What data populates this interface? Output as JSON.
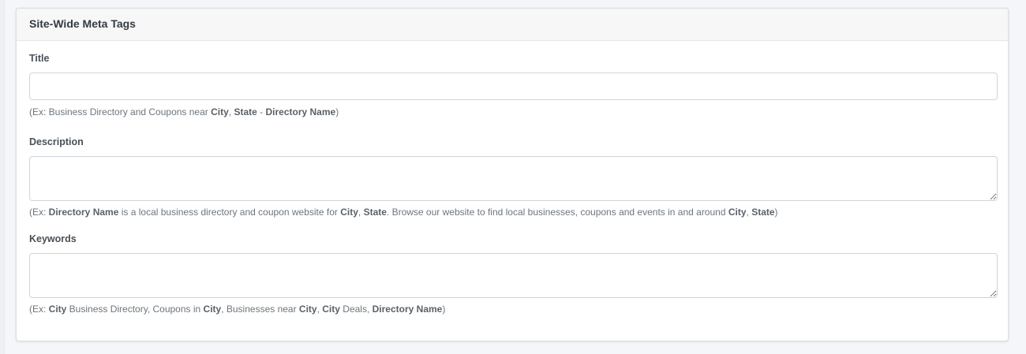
{
  "card": {
    "title": "Site-Wide Meta Tags"
  },
  "fields": {
    "title": {
      "label": "Title",
      "value": "",
      "help": [
        {
          "text": "(Ex: Business Directory and Coupons near ",
          "bold": false
        },
        {
          "text": "City",
          "bold": true
        },
        {
          "text": ", ",
          "bold": false
        },
        {
          "text": "State",
          "bold": true
        },
        {
          "text": " - ",
          "bold": false
        },
        {
          "text": "Directory Name",
          "bold": true
        },
        {
          "text": ")",
          "bold": false
        }
      ]
    },
    "description": {
      "label": "Description",
      "value": "",
      "help": [
        {
          "text": "(Ex: ",
          "bold": false
        },
        {
          "text": "Directory Name",
          "bold": true
        },
        {
          "text": " is a local business directory and coupon website for ",
          "bold": false
        },
        {
          "text": "City",
          "bold": true
        },
        {
          "text": ", ",
          "bold": false
        },
        {
          "text": "State",
          "bold": true
        },
        {
          "text": ". Browse our website to find local businesses, coupons and events in and around ",
          "bold": false
        },
        {
          "text": "City",
          "bold": true
        },
        {
          "text": ", ",
          "bold": false
        },
        {
          "text": "State",
          "bold": true
        },
        {
          "text": ")",
          "bold": false
        }
      ]
    },
    "keywords": {
      "label": "Keywords",
      "value": "",
      "help": [
        {
          "text": "(Ex: ",
          "bold": false
        },
        {
          "text": "City",
          "bold": true
        },
        {
          "text": " Business Directory, Coupons in ",
          "bold": false
        },
        {
          "text": "City",
          "bold": true
        },
        {
          "text": ", Businesses near ",
          "bold": false
        },
        {
          "text": "City",
          "bold": true
        },
        {
          "text": ", ",
          "bold": false
        },
        {
          "text": "City",
          "bold": true
        },
        {
          "text": " Deals, ",
          "bold": false
        },
        {
          "text": "Directory Name",
          "bold": true
        },
        {
          "text": ")",
          "bold": false
        }
      ]
    }
  }
}
